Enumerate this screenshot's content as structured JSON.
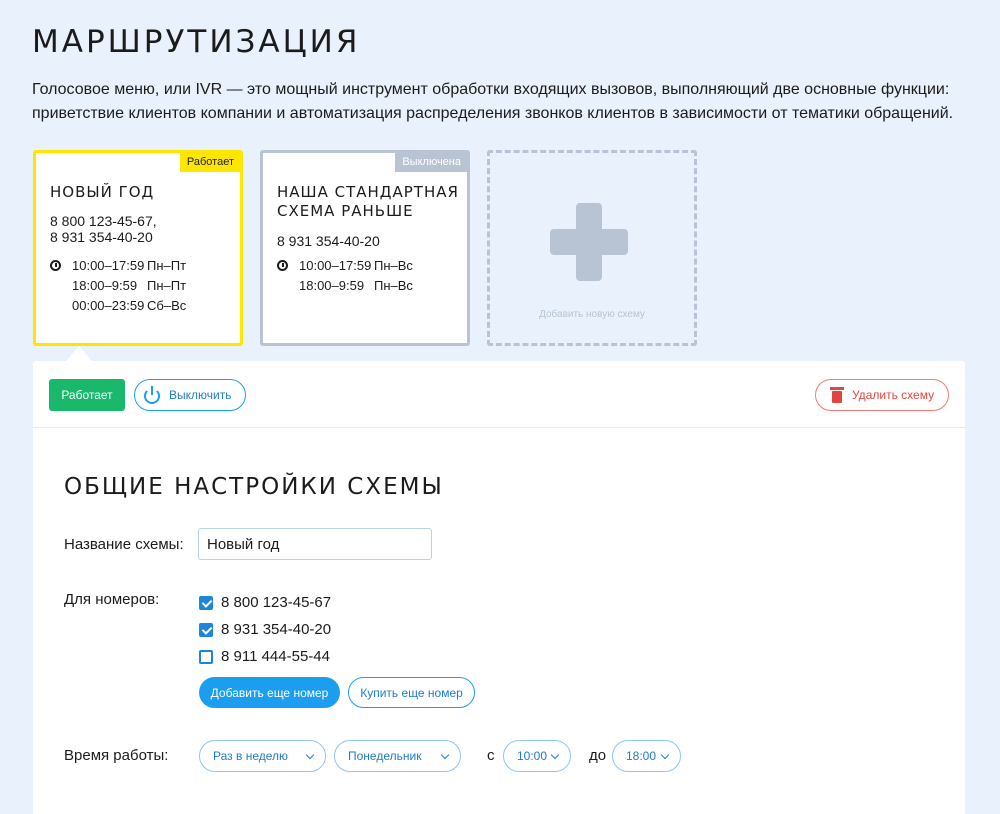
{
  "page": {
    "title": "МАРШРУТИЗАЦИЯ",
    "intro": "Голосовое меню, или IVR — это мощный инструмент обработки входящих вызовов, выполняющий две основные функции: приветствие клиентов компании и автоматизация распределения звонков клиентов в зависимости от тематики обращений."
  },
  "cards": [
    {
      "status": "Работает",
      "title": "НОВЫЙ ГОД",
      "phones": [
        "8 800 123-45-67,",
        "8 931 354-40-20"
      ],
      "schedule": [
        {
          "time": "10:00–17:59",
          "days": "Пн–Пт"
        },
        {
          "time": "18:00–9:59",
          "days": "Пн–Пт"
        },
        {
          "time": "00:00–23:59",
          "days": "Сб–Вс"
        }
      ]
    },
    {
      "status": "Выключена",
      "title": "НАША СТАНДАРТНАЯ СХЕМА РАНЬШЕ",
      "phones": [
        "8 931 354-40-20"
      ],
      "schedule": [
        {
          "time": "10:00–17:59",
          "days": "Пн–Вс"
        },
        {
          "time": "18:00–9:59",
          "days": "Пн–Вс"
        }
      ]
    }
  ],
  "add_card": {
    "label": "Добавить новую схему"
  },
  "toolbar": {
    "status_label": "Работает",
    "disable_label": "Выключить",
    "delete_label": "Удалить схему"
  },
  "settings": {
    "title": "ОБЩИЕ НАСТРОЙКИ СХЕМЫ",
    "name_label": "Название схемы:",
    "name_value": "Новый год",
    "numbers_label": "Для номеров:",
    "numbers": [
      {
        "number": "8 800 123-45-67",
        "checked": true
      },
      {
        "number": "8 931 354-40-20",
        "checked": true
      },
      {
        "number": "8 911 444-55-44",
        "checked": false
      }
    ],
    "add_number_label": "Добавить еще номер",
    "buy_number_label": "Купить еще номер",
    "work_time_label": "Время работы:",
    "frequency": "Раз в неделю",
    "weekday": "Понедельник",
    "from_word": "с",
    "from_time": "10:00",
    "to_word": "до",
    "to_time": "18:00"
  },
  "colors": {
    "background": "#e9f1fc",
    "active_border": "#ffe600",
    "inactive_border": "#b8c4d3",
    "primary": "#1c9ef0",
    "success": "#19b86b",
    "danger": "#e2453f"
  }
}
